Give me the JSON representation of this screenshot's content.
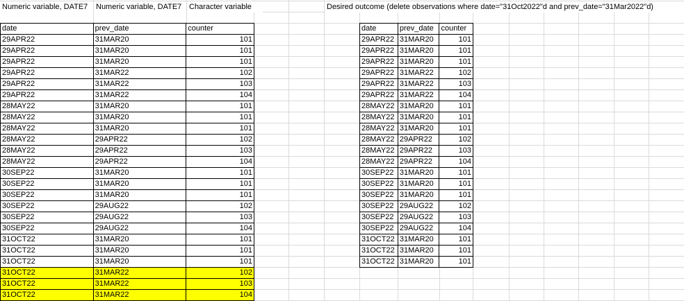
{
  "notes": {
    "a1": "Numeric variable, DATE7",
    "b1": "Numeric variable, DATE7",
    "c1": "Character variable",
    "g1": "Desired outcome (delete observations where date=\"31Oct2022\"d and prev_date=\"31Mar2022\"d)"
  },
  "highlight_color": "#ffff00",
  "headers": [
    "date",
    "prev_date",
    "counter"
  ],
  "source_rows": [
    [
      "29APR22",
      "31MAR20",
      "101"
    ],
    [
      "29APR22",
      "31MAR20",
      "101"
    ],
    [
      "29APR22",
      "31MAR20",
      "101"
    ],
    [
      "29APR22",
      "31MAR22",
      "102"
    ],
    [
      "29APR22",
      "31MAR22",
      "103"
    ],
    [
      "29APR22",
      "31MAR22",
      "104"
    ],
    [
      "28MAY22",
      "31MAR20",
      "101"
    ],
    [
      "28MAY22",
      "31MAR20",
      "101"
    ],
    [
      "28MAY22",
      "31MAR20",
      "101"
    ],
    [
      "28MAY22",
      "29APR22",
      "102"
    ],
    [
      "28MAY22",
      "29APR22",
      "103"
    ],
    [
      "28MAY22",
      "29APR22",
      "104"
    ],
    [
      "30SEP22",
      "31MAR20",
      "101"
    ],
    [
      "30SEP22",
      "31MAR20",
      "101"
    ],
    [
      "30SEP22",
      "31MAR20",
      "101"
    ],
    [
      "30SEP22",
      "29AUG22",
      "102"
    ],
    [
      "30SEP22",
      "29AUG22",
      "103"
    ],
    [
      "30SEP22",
      "29AUG22",
      "104"
    ],
    [
      "31OCT22",
      "31MAR20",
      "101"
    ],
    [
      "31OCT22",
      "31MAR20",
      "101"
    ],
    [
      "31OCT22",
      "31MAR20",
      "101"
    ],
    [
      "31OCT22",
      "31MAR22",
      "102"
    ],
    [
      "31OCT22",
      "31MAR22",
      "103"
    ],
    [
      "31OCT22",
      "31MAR22",
      "104"
    ]
  ],
  "highlighted_rows": [
    21,
    22,
    23
  ],
  "outcome_rows": [
    [
      "29APR22",
      "31MAR20",
      "101"
    ],
    [
      "29APR22",
      "31MAR20",
      "101"
    ],
    [
      "29APR22",
      "31MAR20",
      "101"
    ],
    [
      "29APR22",
      "31MAR22",
      "102"
    ],
    [
      "29APR22",
      "31MAR22",
      "103"
    ],
    [
      "29APR22",
      "31MAR22",
      "104"
    ],
    [
      "28MAY22",
      "31MAR20",
      "101"
    ],
    [
      "28MAY22",
      "31MAR20",
      "101"
    ],
    [
      "28MAY22",
      "31MAR20",
      "101"
    ],
    [
      "28MAY22",
      "29APR22",
      "102"
    ],
    [
      "28MAY22",
      "29APR22",
      "103"
    ],
    [
      "28MAY22",
      "29APR22",
      "104"
    ],
    [
      "30SEP22",
      "31MAR20",
      "101"
    ],
    [
      "30SEP22",
      "31MAR20",
      "101"
    ],
    [
      "30SEP22",
      "31MAR20",
      "101"
    ],
    [
      "30SEP22",
      "29AUG22",
      "102"
    ],
    [
      "30SEP22",
      "29AUG22",
      "103"
    ],
    [
      "30SEP22",
      "29AUG22",
      "104"
    ],
    [
      "31OCT22",
      "31MAR20",
      "101"
    ],
    [
      "31OCT22",
      "31MAR20",
      "101"
    ],
    [
      "31OCT22",
      "31MAR20",
      "101"
    ]
  ]
}
